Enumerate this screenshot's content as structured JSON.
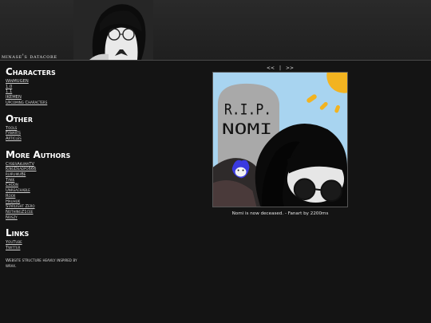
{
  "header": {
    "site_title": "minase's datacore"
  },
  "sidebar": {
    "sections": [
      {
        "title": "Characters",
        "links": [
          "WinMUGEN",
          "1.0",
          "1.1",
          "IKEMEN",
          "Upcoming Characters"
        ]
      },
      {
        "title": "Other",
        "links": [
          "Tools",
          "Fanarts",
          "Articles"
        ]
      },
      {
        "title": "More Authors",
        "links": [
          "CyberAkumaTV",
          "KingDeadpo666",
          "ruiruikuBe",
          "Takk",
          "Choon",
          "Unreachable",
          "Roox",
          "Hauhuk",
          "Starlight Zero",
          "NothingZ1cee",
          "Noszy"
        ]
      },
      {
        "title": "Links",
        "links": [
          "YouTube",
          "Twitter"
        ]
      }
    ],
    "credit": "Website structure heavily inspired by wrax."
  },
  "gallery": {
    "prev": "<<",
    "separator": "|",
    "next": ">>",
    "tombstone_text": "R.I.P. NOMI",
    "caption": "Nomi is now deceased. - Fanart by 2200ms"
  },
  "colors": {
    "background": "#141414",
    "header": "#242424",
    "sky": "#a8d4f0",
    "sun": "#f2b320",
    "tombstone": "#a9a9a9"
  }
}
